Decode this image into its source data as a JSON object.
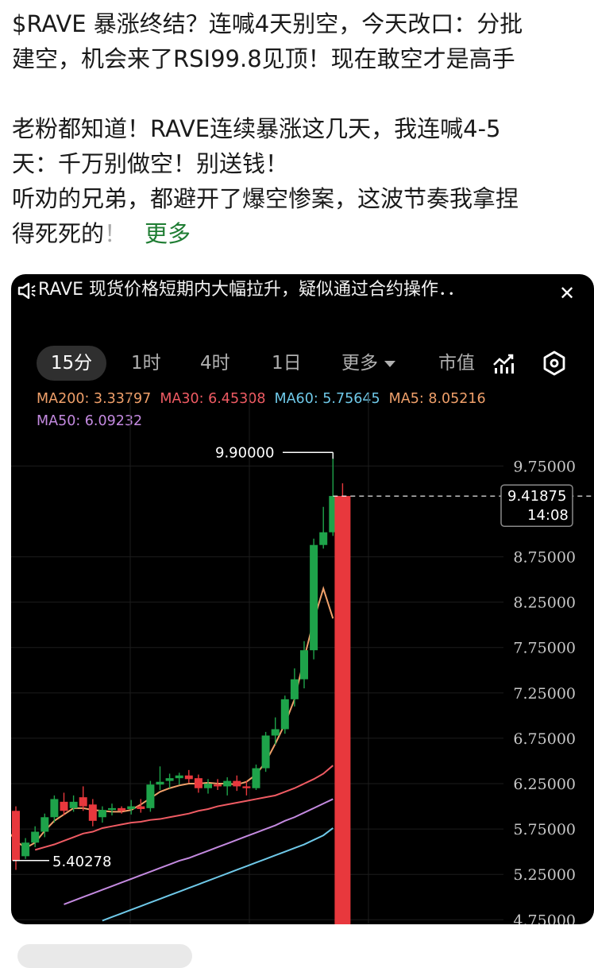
{
  "post": {
    "line1": "$RAVE 暴涨终结？连喊4天别空，今天改口：分批",
    "line2": "建空，机会来了RSI99.8见顶！现在敢空才是高手",
    "line3": "老粉都知道！RAVE连续暴涨这几天，我连喊4-5",
    "line4": "天：千万别做空！别送钱！",
    "line5": "听劝的兄弟，都避开了爆空惨案，这波节奏我拿捏",
    "line6": "得死死的",
    "line6_fade": "！",
    "more_label": "更多"
  },
  "chart_card": {
    "notice": "RAVE 现货价格短期内大幅拉升，疑似通过合约操作．．",
    "tabs": [
      "15分",
      "1时",
      "4时",
      "1日"
    ],
    "more_tab": "更多",
    "market_cap_tab": "市值",
    "indicators": [
      {
        "label": "MA200: 3.33797",
        "color": "#f0a06a"
      },
      {
        "label": "MA30: 6.45308",
        "color": "#ef5b63"
      },
      {
        "label": "MA60: 5.75645",
        "color": "#6fc9e9"
      },
      {
        "label": "MA5: 8.05216",
        "color": "#f0a06a"
      },
      {
        "label": "MA50: 6.09232",
        "color": "#c48ae0"
      }
    ],
    "high_label": "9.90000",
    "low_label": "5.40278",
    "price_label": "9.41875",
    "time_label": "14:08"
  },
  "chart_data": {
    "type": "candlestick",
    "y_ticks": [
      "9.75000",
      "8.75000",
      "8.25000",
      "7.75000",
      "7.25000",
      "6.75000",
      "6.25000",
      "5.75000",
      "5.25000",
      "4.75000"
    ],
    "ylim": [
      4.7,
      10.2
    ],
    "current_price": 9.41875,
    "high": 9.9,
    "low": 5.40278,
    "up_color": "#1ea34a",
    "down_color": "#e8383d",
    "candles": [
      {
        "o": 5.95,
        "h": 6.0,
        "l": 5.3,
        "c": 5.4
      },
      {
        "o": 5.45,
        "h": 5.65,
        "l": 5.42,
        "c": 5.6
      },
      {
        "o": 5.6,
        "h": 5.78,
        "l": 5.55,
        "c": 5.72
      },
      {
        "o": 5.72,
        "h": 5.92,
        "l": 5.66,
        "c": 5.88
      },
      {
        "o": 5.88,
        "h": 6.12,
        "l": 5.82,
        "c": 6.08
      },
      {
        "o": 6.05,
        "h": 6.15,
        "l": 5.9,
        "c": 5.95
      },
      {
        "o": 5.98,
        "h": 6.12,
        "l": 5.94,
        "c": 6.05
      },
      {
        "o": 6.1,
        "h": 6.22,
        "l": 5.95,
        "c": 6.0
      },
      {
        "o": 6.02,
        "h": 6.08,
        "l": 5.78,
        "c": 5.84
      },
      {
        "o": 5.88,
        "h": 6.0,
        "l": 5.82,
        "c": 5.96
      },
      {
        "o": 5.96,
        "h": 6.03,
        "l": 5.9,
        "c": 5.98
      },
      {
        "o": 5.98,
        "h": 6.0,
        "l": 5.92,
        "c": 5.95
      },
      {
        "o": 5.97,
        "h": 6.07,
        "l": 5.91,
        "c": 6.0
      },
      {
        "o": 6.0,
        "h": 6.08,
        "l": 5.93,
        "c": 5.97
      },
      {
        "o": 5.98,
        "h": 6.28,
        "l": 5.94,
        "c": 6.24
      },
      {
        "o": 6.24,
        "h": 6.44,
        "l": 6.18,
        "c": 6.27
      },
      {
        "o": 6.28,
        "h": 6.36,
        "l": 6.2,
        "c": 6.31
      },
      {
        "o": 6.31,
        "h": 6.37,
        "l": 6.24,
        "c": 6.34
      },
      {
        "o": 6.34,
        "h": 6.4,
        "l": 6.26,
        "c": 6.3
      },
      {
        "o": 6.31,
        "h": 6.35,
        "l": 6.15,
        "c": 6.2
      },
      {
        "o": 6.2,
        "h": 6.3,
        "l": 6.14,
        "c": 6.25
      },
      {
        "o": 6.24,
        "h": 6.3,
        "l": 6.18,
        "c": 6.22
      },
      {
        "o": 6.22,
        "h": 6.32,
        "l": 6.12,
        "c": 6.28
      },
      {
        "o": 6.28,
        "h": 6.34,
        "l": 6.17,
        "c": 6.22
      },
      {
        "o": 6.22,
        "h": 6.28,
        "l": 6.12,
        "c": 6.2
      },
      {
        "o": 6.2,
        "h": 6.46,
        "l": 6.18,
        "c": 6.42
      },
      {
        "o": 6.42,
        "h": 6.82,
        "l": 6.38,
        "c": 6.78
      },
      {
        "o": 6.78,
        "h": 6.98,
        "l": 6.68,
        "c": 6.85
      },
      {
        "o": 6.85,
        "h": 7.22,
        "l": 6.8,
        "c": 7.18
      },
      {
        "o": 7.18,
        "h": 7.52,
        "l": 7.1,
        "c": 7.4
      },
      {
        "o": 7.4,
        "h": 7.82,
        "l": 7.3,
        "c": 7.72
      },
      {
        "o": 7.72,
        "h": 8.95,
        "l": 7.62,
        "c": 8.88
      },
      {
        "o": 8.88,
        "h": 9.3,
        "l": 8.84,
        "c": 9.02
      },
      {
        "o": 9.02,
        "h": 9.9,
        "l": 8.98,
        "c": 9.42
      },
      {
        "o": 9.42,
        "h": 9.56,
        "l": 4.68,
        "c": 4.7
      }
    ],
    "ma_lines": [
      {
        "name": "MA5",
        "color": "#f0a06a",
        "values": [
          5.75,
          5.62,
          5.54,
          5.6,
          5.73,
          5.84,
          5.91,
          5.98,
          5.98,
          5.96,
          5.95,
          5.94,
          5.94,
          5.96,
          6.02,
          6.09,
          6.16,
          6.2,
          6.23,
          6.25,
          6.25,
          6.26,
          6.25,
          6.25,
          6.24,
          6.27,
          6.35,
          6.49,
          6.69,
          6.91,
          7.18,
          7.63,
          8.05,
          8.4,
          8.07
        ]
      },
      {
        "name": "MA30",
        "color": "#ef5b63",
        "values": [
          5.52,
          5.55,
          5.58,
          5.62,
          5.66,
          5.7,
          5.72,
          5.76,
          5.78,
          5.8,
          5.82,
          5.83,
          5.85,
          5.86,
          5.88,
          5.9,
          5.92,
          5.95,
          5.97,
          6.0,
          6.02,
          6.04,
          6.06,
          6.08,
          6.1,
          6.12,
          6.16,
          6.2,
          6.25,
          6.3,
          6.36,
          6.45
        ]
      },
      {
        "name": "MA50",
        "color": "#c48ae0",
        "values": [
          4.92,
          4.96,
          5.0,
          5.04,
          5.08,
          5.12,
          5.16,
          5.2,
          5.24,
          5.28,
          5.32,
          5.36,
          5.4,
          5.43,
          5.47,
          5.51,
          5.55,
          5.59,
          5.63,
          5.67,
          5.71,
          5.75,
          5.79,
          5.84,
          5.88,
          5.93,
          5.98,
          6.03,
          6.08
        ]
      },
      {
        "name": "MA60",
        "color": "#6fc9e9",
        "values": [
          4.74,
          4.78,
          4.82,
          4.86,
          4.9,
          4.94,
          4.98,
          5.02,
          5.06,
          5.1,
          5.14,
          5.18,
          5.22,
          5.26,
          5.3,
          5.34,
          5.38,
          5.42,
          5.46,
          5.5,
          5.54,
          5.58,
          5.63,
          5.68,
          5.76
        ]
      }
    ]
  }
}
